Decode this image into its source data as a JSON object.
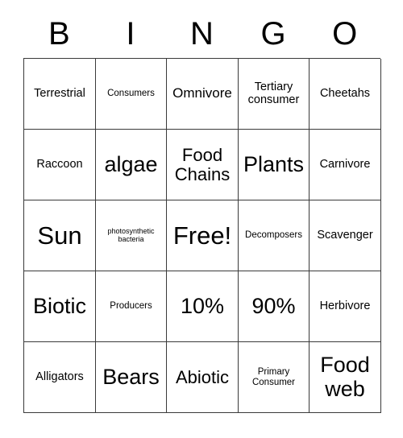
{
  "card": {
    "title": "BINGO",
    "header_letters": [
      "B",
      "I",
      "N",
      "G",
      "O"
    ],
    "free_space_label": "Free!",
    "colors": {
      "background": "#ffffff",
      "grid_line": "#3a3a3a",
      "text": "#000000"
    },
    "rows": [
      [
        {
          "text": "Terrestrial",
          "size": "sz-m"
        },
        {
          "text": "Consumers",
          "size": "sz-s"
        },
        {
          "text": "Omnivore",
          "size": "sz-l"
        },
        {
          "text": "Tertiary consumer",
          "size": "sz-m"
        },
        {
          "text": "Cheetahs",
          "size": "sz-m"
        }
      ],
      [
        {
          "text": "Raccoon",
          "size": "sz-m"
        },
        {
          "text": "algae",
          "size": "sz-xxl"
        },
        {
          "text": "Food Chains",
          "size": "sz-xl"
        },
        {
          "text": "Plants",
          "size": "sz-xxl"
        },
        {
          "text": "Carnivore",
          "size": "sz-m"
        }
      ],
      [
        {
          "text": "Sun",
          "size": "sz-3xl"
        },
        {
          "text": "photosynthetic bacteria",
          "size": "sz-xs"
        },
        {
          "text": "Free!",
          "size": "sz-3xl"
        },
        {
          "text": "Decomposers",
          "size": "sz-s"
        },
        {
          "text": "Scavenger",
          "size": "sz-m"
        }
      ],
      [
        {
          "text": "Biotic",
          "size": "sz-xxl"
        },
        {
          "text": "Producers",
          "size": "sz-s"
        },
        {
          "text": "10%",
          "size": "sz-xxl"
        },
        {
          "text": "90%",
          "size": "sz-xxl"
        },
        {
          "text": "Herbivore",
          "size": "sz-m"
        }
      ],
      [
        {
          "text": "Alligators",
          "size": "sz-m"
        },
        {
          "text": "Bears",
          "size": "sz-xxl"
        },
        {
          "text": "Abiotic",
          "size": "sz-xl"
        },
        {
          "text": "Primary Consumer",
          "size": "sz-s"
        },
        {
          "text": "Food web",
          "size": "sz-xxl"
        }
      ]
    ]
  }
}
